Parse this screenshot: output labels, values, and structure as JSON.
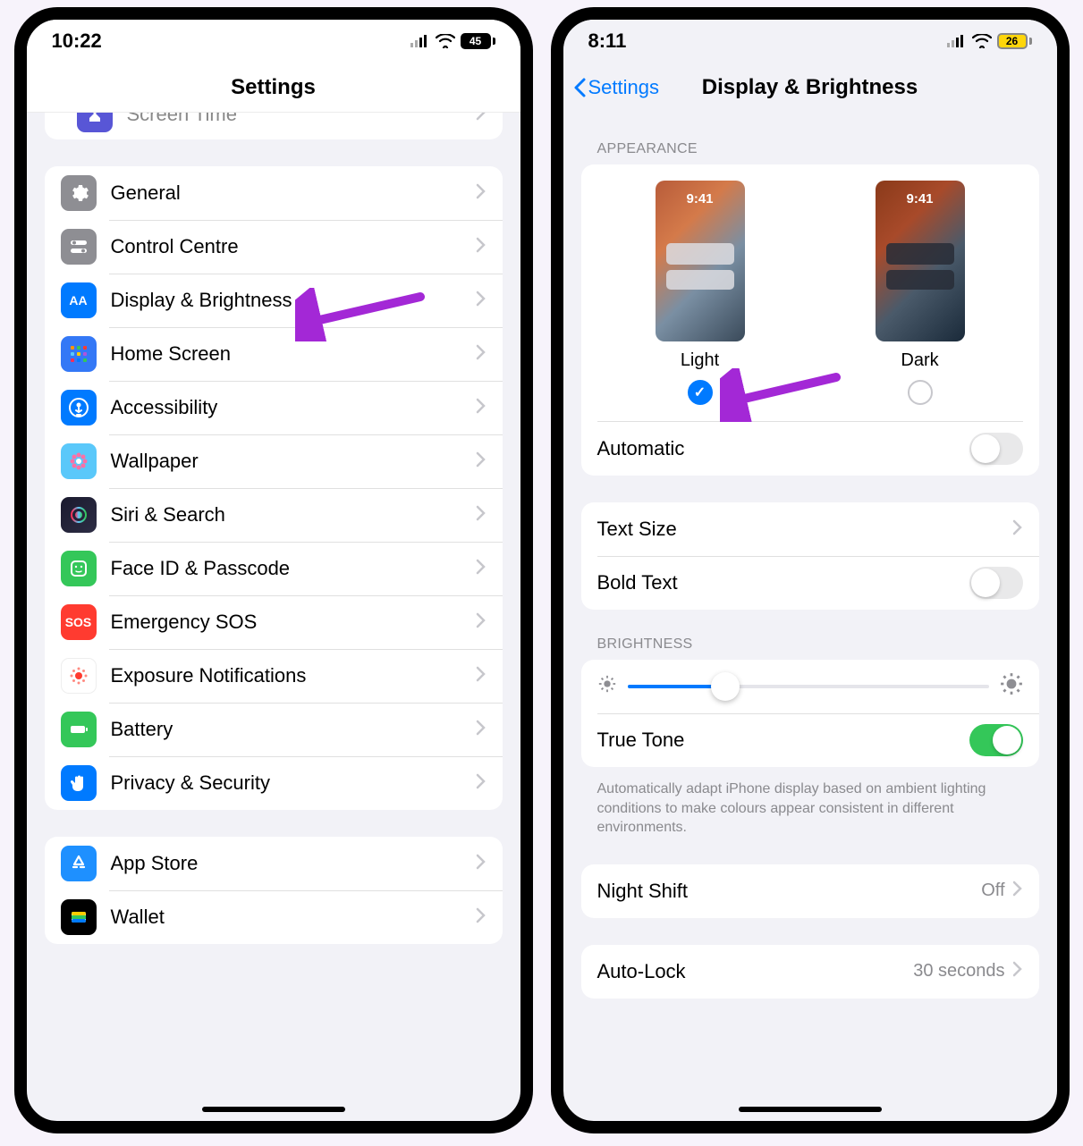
{
  "left": {
    "status": {
      "time": "10:22",
      "battery": "45"
    },
    "nav": {
      "title": "Settings"
    },
    "peek_label": "Screen Time",
    "rows_group1": [
      {
        "label": "General",
        "icon": "gear",
        "color": "ic-gray"
      },
      {
        "label": "Control Centre",
        "icon": "switches",
        "color": "ic-gray"
      },
      {
        "label": "Display & Brightness",
        "icon": "aa",
        "color": "ic-blue"
      },
      {
        "label": "Home Screen",
        "icon": "apps",
        "color": "ic-apps"
      },
      {
        "label": "Accessibility",
        "icon": "person",
        "color": "ic-blue"
      },
      {
        "label": "Wallpaper",
        "icon": "flower",
        "color": "ic-teal"
      },
      {
        "label": "Siri & Search",
        "icon": "siri",
        "color": "ic-siri"
      },
      {
        "label": "Face ID & Passcode",
        "icon": "face",
        "color": "ic-green"
      },
      {
        "label": "Emergency SOS",
        "icon": "sos",
        "color": "ic-red"
      },
      {
        "label": "Exposure Notifications",
        "icon": "exn",
        "color": "ic-exn"
      },
      {
        "label": "Battery",
        "icon": "battery",
        "color": "ic-green"
      },
      {
        "label": "Privacy & Security",
        "icon": "hand",
        "color": "ic-hand"
      }
    ],
    "rows_group2": [
      {
        "label": "App Store",
        "icon": "appstore",
        "color": "ic-store"
      },
      {
        "label": "Wallet",
        "icon": "wallet",
        "color": "ic-wallet"
      }
    ]
  },
  "right": {
    "status": {
      "time": "8:11",
      "battery": "26"
    },
    "nav": {
      "back": "Settings",
      "title": "Display & Brightness"
    },
    "appearance": {
      "header": "APPEARANCE",
      "light_label": "Light",
      "dark_label": "Dark",
      "preview_time": "9:41",
      "selected": "light",
      "automatic_label": "Automatic",
      "automatic_on": false
    },
    "text": {
      "text_size": "Text Size",
      "bold_text": "Bold Text",
      "bold_on": false
    },
    "brightness": {
      "header": "BRIGHTNESS",
      "value_pct": 27,
      "true_tone_label": "True Tone",
      "true_tone_on": true,
      "footnote": "Automatically adapt iPhone display based on ambient lighting conditions to make colours appear consistent in different environments."
    },
    "night_shift": {
      "label": "Night Shift",
      "value": "Off"
    },
    "auto_lock": {
      "label": "Auto-Lock",
      "value": "30 seconds"
    }
  },
  "colors": {
    "accent": "#007aff",
    "arrow": "#a328d6"
  }
}
